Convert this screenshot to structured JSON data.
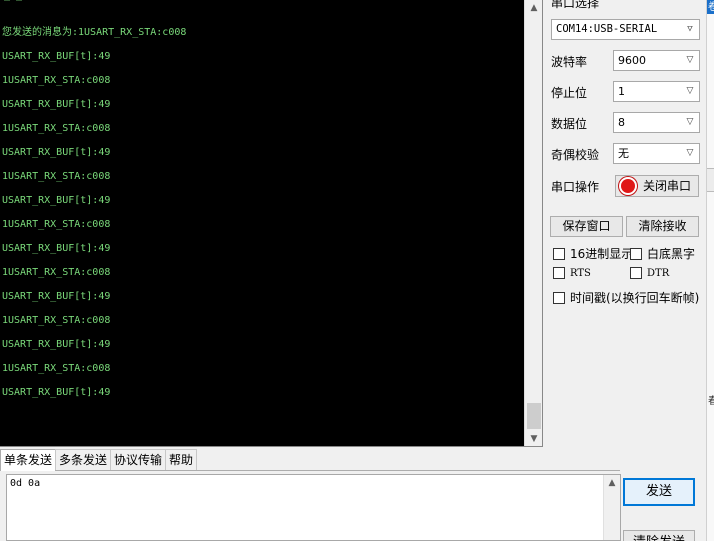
{
  "terminal": {
    "top_fragment": "_ _",
    "lines": [
      "您发送的消息为:1USART_RX_STA:c008",
      "USART_RX_BUF[t]:49",
      "1USART_RX_STA:c008",
      "USART_RX_BUF[t]:49",
      "1USART_RX_STA:c008",
      "USART_RX_BUF[t]:49",
      "1USART_RX_STA:c008",
      "USART_RX_BUF[t]:49",
      "1USART_RX_STA:c008",
      "USART_RX_BUF[t]:49",
      "1USART_RX_STA:c008",
      "USART_RX_BUF[t]:49",
      "1USART_RX_STA:c008",
      "USART_RX_BUF[t]:49",
      "1USART_RX_STA:c008",
      "USART_RX_BUF[t]:49"
    ],
    "text_color": "#7ad97a",
    "background": "#000000"
  },
  "panel": {
    "port_select_label": "串口选择",
    "port_value": "COM14:USB-SERIAL",
    "baud_label": "波特率",
    "baud_value": "9600",
    "stop_label": "停止位",
    "stop_value": "1",
    "data_label": "数据位",
    "data_value": "8",
    "parity_label": "奇偶校验",
    "parity_value": "无",
    "operation_label": "串口操作",
    "close_port_button": "关闭串口",
    "save_window_button": "保存窗口",
    "clear_receive_button": "清除接收",
    "hex_display_label": "16进制显示",
    "white_bg_label": "白底黑字",
    "rts_label": "RTS",
    "dtr_label": "DTR",
    "timestamp_label": "时间戳(以换行回车断帧)"
  },
  "tabs": [
    "单条发送",
    "多条发送",
    "协议传输",
    "帮助"
  ],
  "send": {
    "input_value": "0d 0a",
    "send_button": "发送",
    "clear_send_button": "清除发送"
  },
  "edge_fragments": [
    "卷",
    "春"
  ],
  "colors": {
    "accent": "#0078d7",
    "record": "#e01818"
  },
  "icons": {
    "dropdown": "chevron-down-icon",
    "record": "record-icon",
    "scroll_up": "arrow-up-icon",
    "scroll_down": "arrow-down-icon"
  }
}
